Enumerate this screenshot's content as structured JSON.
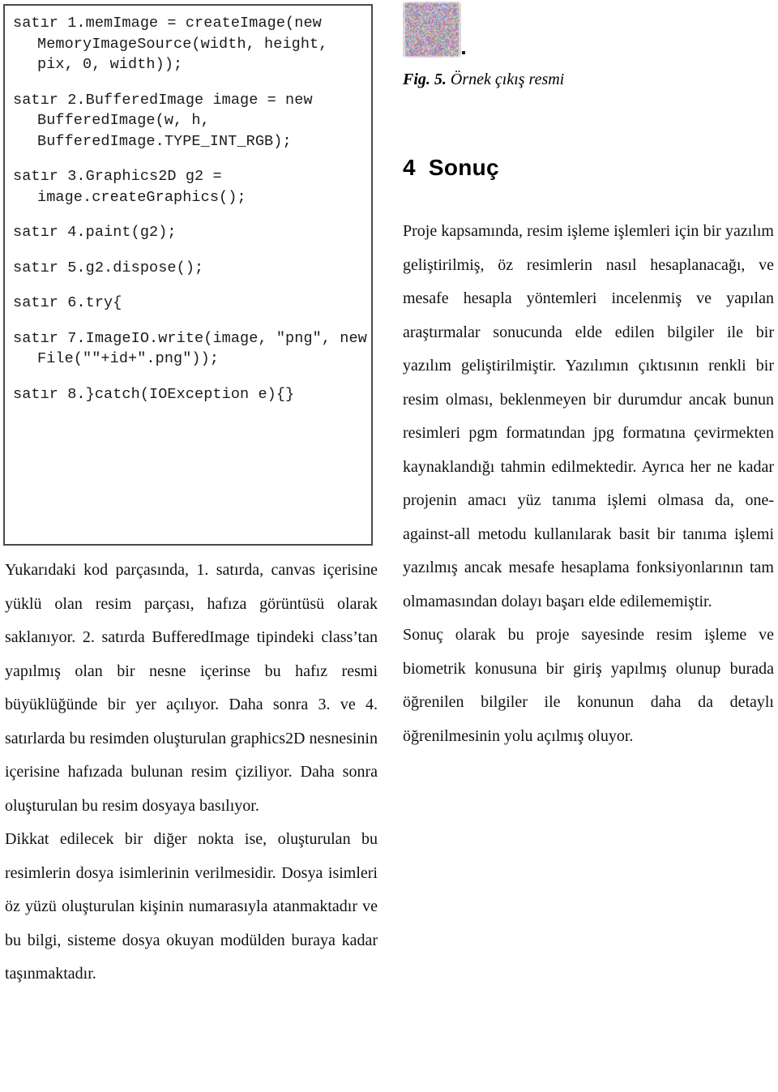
{
  "code_listing": {
    "lines": [
      "satır 1.memImage = createImage(new MemoryImageSource(width, height, pix, 0, width));",
      "satır 2.BufferedImage image = new BufferedImage(w, h, BufferedImage.TYPE_INT_RGB);",
      "satır 3.Graphics2D g2 = image.createGraphics();",
      "satır 4.paint(g2);",
      "satır 5.g2.dispose();",
      "satır 6.try{",
      "satır 7.ImageIO.write(image, \"png\", new File(\"\"+id+\".png\"));",
      "satır 8.}catch(IOException e){}"
    ]
  },
  "left_column": {
    "paragraphs": [
      "Yukarıdaki kod parçasında, 1. satırda, canvas içerisine yüklü olan resim parçası, hafıza görüntüsü olarak saklanıyor. 2. satırda BufferedImage tipindeki class’tan yapılmış olan bir nesne içerinse bu hafız resmi büyüklüğünde bir yer açılıyor. Daha sonra 3. ve 4. satırlarda bu resimden oluşturulan graphics2D nesnesinin içerisine hafızada bulunan resim çiziliyor. Daha sonra oluşturulan bu resim dosyaya basılıyor.",
      "Dikkat edilecek bir diğer nokta ise, oluşturulan bu resimlerin dosya isimlerinin verilmesidir. Dosya isimleri öz yüzü oluşturulan kişinin numarasıyla atanmaktadır ve bu bilgi, sisteme dosya okuyan modülden buraya kadar taşınmaktadır."
    ]
  },
  "figure": {
    "caption_label": "Fig. 5.",
    "caption_text": " Örnek çıkış resmi",
    "image_name": "sample-output-noise-image"
  },
  "section": {
    "number": "4",
    "title": "Sonuç"
  },
  "right_column": {
    "paragraphs": [
      "Proje kapsamında, resim işleme işlemleri için bir yazılım geliştirilmiş, öz resimlerin nasıl hesaplanacağı, ve mesafe hesapla yöntemleri incelenmiş ve yapılan araştırmalar sonucunda elde edilen bilgiler ile bir yazılım geliştirilmiştir. Yazılımın çıktısının renkli bir resim olması, beklenmeyen bir durumdur ancak bunun resimleri pgm formatından jpg formatına çevirmekten kaynaklandığı tahmin edilmektedir. Ayrıca her ne kadar projenin amacı yüz tanıma işlemi olmasa da, one-against-all metodu kullanılarak basit bir tanıma işlemi yazılmış ancak mesafe hesaplama fonksiyonlarının tam olmamasından dolayı başarı elde edilememiştir.",
      "Sonuç olarak bu proje sayesinde resim işleme ve biometrik konusuna bir giriş yapılmış olunup burada öğrenilen bilgiler ile konunun daha da detaylı öğrenilmesinin yolu açılmış oluyor."
    ]
  },
  "colors": {
    "text": "#111111",
    "code_border": "#4a4a4a",
    "background": "#ffffff"
  }
}
